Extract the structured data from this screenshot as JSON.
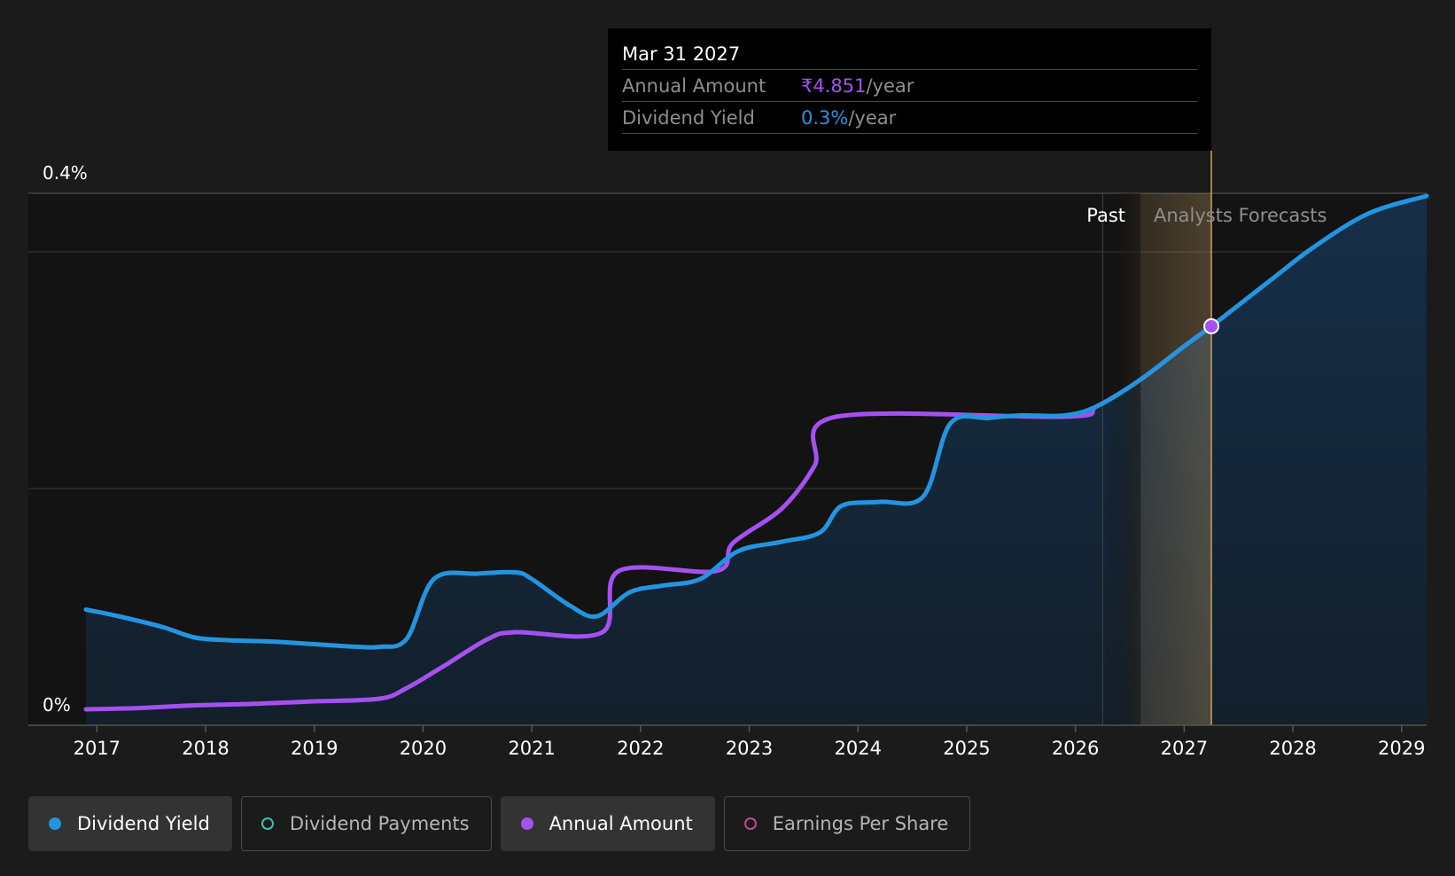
{
  "tooltip": {
    "date": "Mar 31 2027",
    "rows": [
      {
        "label": "Annual Amount",
        "value": "₹4.851",
        "unit": "/year"
      },
      {
        "label": "Dividend Yield",
        "value": "0.3%",
        "unit": "/year"
      }
    ]
  },
  "legend": [
    {
      "label": "Dividend Yield",
      "color": "#2394df",
      "filled": true,
      "active": true
    },
    {
      "label": "Dividend Payments",
      "color": "#3fbfb3",
      "filled": false,
      "active": false
    },
    {
      "label": "Annual Amount",
      "color": "#a550f0",
      "filled": true,
      "active": true
    },
    {
      "label": "Earnings Per Share",
      "color": "#c04c8a",
      "filled": false,
      "active": false
    }
  ],
  "chart_data": {
    "type": "line",
    "x_ticks": [
      "2017",
      "2018",
      "2019",
      "2020",
      "2021",
      "2022",
      "2023",
      "2024",
      "2025",
      "2026",
      "2027",
      "2028",
      "2029"
    ],
    "y_ticks": [
      "0.4%",
      "0%"
    ],
    "ylim": [
      0,
      0.4
    ],
    "xlim": [
      2016.37,
      2029.23
    ],
    "past_label": "Past",
    "forecast_label": "Analysts Forecasts",
    "past_end": 2026.25,
    "forecast_highlight": [
      2026.6,
      2027.25
    ],
    "highlight_x": 2027.25,
    "colors": {
      "yield": "#2394df",
      "amount": "#a550f0",
      "highlight": "#c8a064"
    },
    "series": [
      {
        "key": "yield",
        "name": "Dividend Yield",
        "points": [
          [
            2016.9,
            0.087
          ],
          [
            2017.2,
            0.082
          ],
          [
            2017.6,
            0.074
          ],
          [
            2017.9,
            0.066
          ],
          [
            2018.2,
            0.064
          ],
          [
            2018.6,
            0.063
          ],
          [
            2019.0,
            0.061
          ],
          [
            2019.4,
            0.059
          ],
          [
            2019.6,
            0.059
          ],
          [
            2019.85,
            0.065
          ],
          [
            2020.1,
            0.11
          ],
          [
            2020.5,
            0.114
          ],
          [
            2020.85,
            0.115
          ],
          [
            2021.0,
            0.11
          ],
          [
            2021.35,
            0.09
          ],
          [
            2021.6,
            0.082
          ],
          [
            2021.9,
            0.1
          ],
          [
            2022.2,
            0.105
          ],
          [
            2022.55,
            0.11
          ],
          [
            2022.9,
            0.131
          ],
          [
            2023.3,
            0.138
          ],
          [
            2023.65,
            0.145
          ],
          [
            2023.85,
            0.165
          ],
          [
            2024.2,
            0.168
          ],
          [
            2024.6,
            0.172
          ],
          [
            2024.85,
            0.227
          ],
          [
            2025.2,
            0.231
          ],
          [
            2025.5,
            0.233
          ],
          [
            2025.9,
            0.233
          ],
          [
            2026.2,
            0.24
          ],
          [
            2026.6,
            0.26
          ],
          [
            2027.0,
            0.285
          ],
          [
            2027.25,
            0.3
          ],
          [
            2027.8,
            0.335
          ],
          [
            2028.2,
            0.36
          ],
          [
            2028.7,
            0.385
          ],
          [
            2029.23,
            0.398
          ]
        ]
      },
      {
        "key": "amount",
        "name": "Annual Amount",
        "points": [
          [
            2016.9,
            0.012
          ],
          [
            2017.4,
            0.013
          ],
          [
            2017.9,
            0.015
          ],
          [
            2018.4,
            0.016
          ],
          [
            2018.7,
            0.017
          ],
          [
            2019.0,
            0.018
          ],
          [
            2019.6,
            0.02
          ],
          [
            2019.85,
            0.028
          ],
          [
            2020.2,
            0.045
          ],
          [
            2020.6,
            0.065
          ],
          [
            2020.85,
            0.07
          ],
          [
            2021.65,
            0.07
          ],
          [
            2021.8,
            0.116
          ],
          [
            2022.7,
            0.116
          ],
          [
            2022.85,
            0.137
          ],
          [
            2023.3,
            0.163
          ],
          [
            2023.6,
            0.195
          ],
          [
            2023.8,
            0.232
          ],
          [
            2025.9,
            0.232
          ],
          [
            2026.2,
            0.24
          ],
          [
            2026.6,
            0.26
          ],
          [
            2027.0,
            0.285
          ],
          [
            2027.25,
            0.3
          ]
        ]
      }
    ],
    "highlight_value": 0.3
  }
}
